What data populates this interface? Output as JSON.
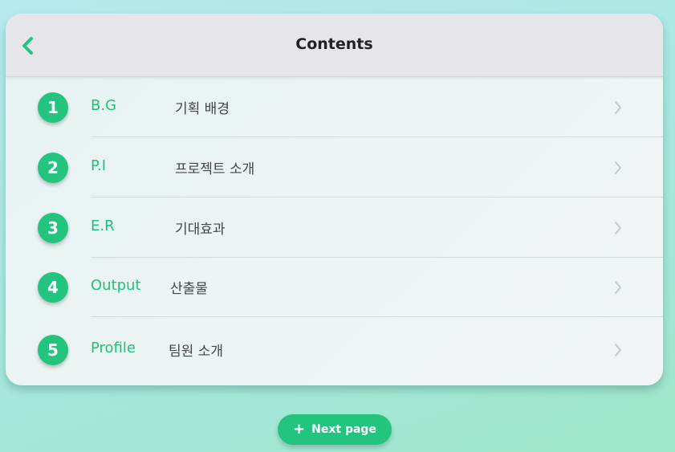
{
  "header": {
    "title": "Contents"
  },
  "items": [
    {
      "number": "1",
      "code": "B.G",
      "description": "기획 배경"
    },
    {
      "number": "2",
      "code": "P.I",
      "description": "프로젝트 소개"
    },
    {
      "number": "3",
      "code": "E.R",
      "description": "기대효과"
    },
    {
      "number": "4",
      "code": "Output",
      "description": "산출물"
    },
    {
      "number": "5",
      "code": "Profile",
      "description": "팀원 소개"
    }
  ],
  "footer": {
    "next_label": "Next page",
    "plus_icon": "+"
  },
  "colors": {
    "accent": "#23c47e",
    "header_bg": "#e5e5ea"
  },
  "icons": {
    "back": "chevron-left-icon",
    "row_arrow": "chevron-right-icon"
  }
}
